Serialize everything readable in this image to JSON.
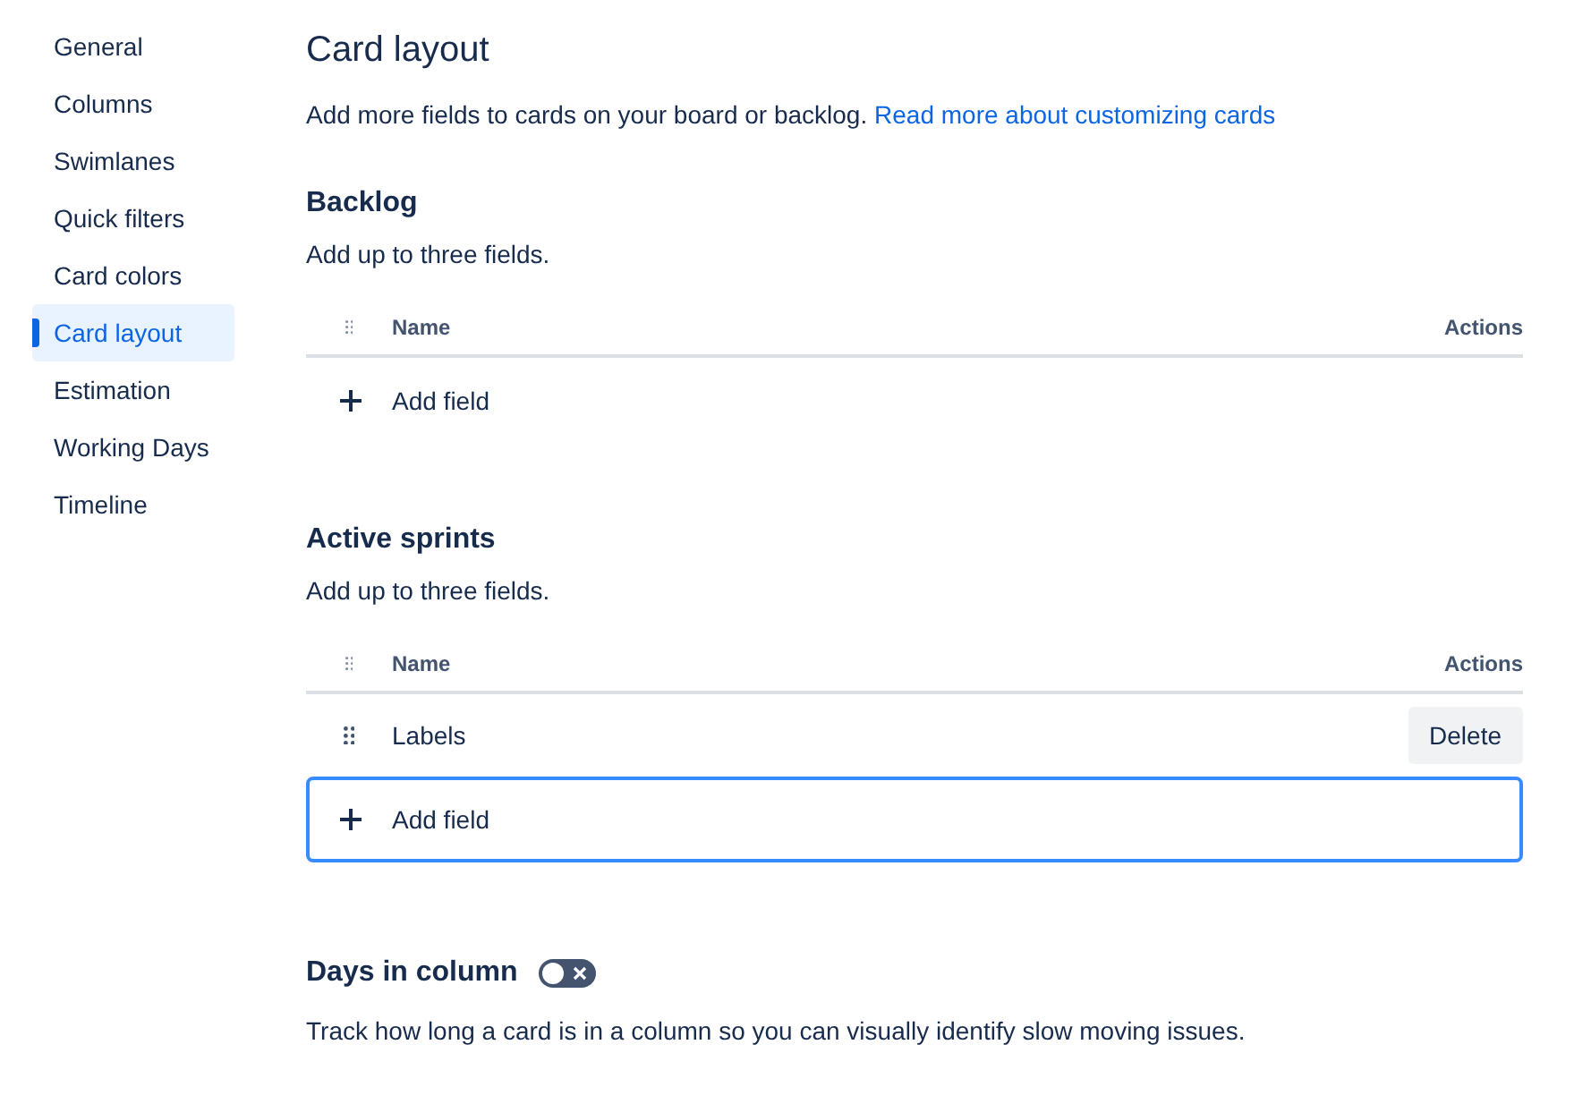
{
  "sidebar": {
    "items": [
      {
        "label": "General",
        "selected": false
      },
      {
        "label": "Columns",
        "selected": false
      },
      {
        "label": "Swimlanes",
        "selected": false
      },
      {
        "label": "Quick filters",
        "selected": false
      },
      {
        "label": "Card colors",
        "selected": false
      },
      {
        "label": "Card layout",
        "selected": true
      },
      {
        "label": "Estimation",
        "selected": false
      },
      {
        "label": "Working Days",
        "selected": false
      },
      {
        "label": "Timeline",
        "selected": false
      }
    ]
  },
  "page": {
    "title": "Card layout",
    "description": "Add more fields to cards on your board or backlog.",
    "link": "Read more about customizing cards"
  },
  "sections": [
    {
      "heading": "Backlog",
      "hint": "Add up to three fields.",
      "columns": [
        "Name",
        "Actions"
      ],
      "add_button": {
        "label": "Add field",
        "focused": false
      }
    },
    {
      "heading": "Active sprints",
      "hint": "Add up to three fields.",
      "columns": [
        "Name",
        "Actions"
      ],
      "rows": [
        {
          "name": "Labels",
          "action": "Delete"
        }
      ],
      "add_button": {
        "label": "Add field",
        "focused": true
      }
    }
  ],
  "days_in_column": {
    "heading": "Days in column",
    "on": false,
    "description": "Track how long a card is in a column so you can visually identify slow moving issues."
  }
}
